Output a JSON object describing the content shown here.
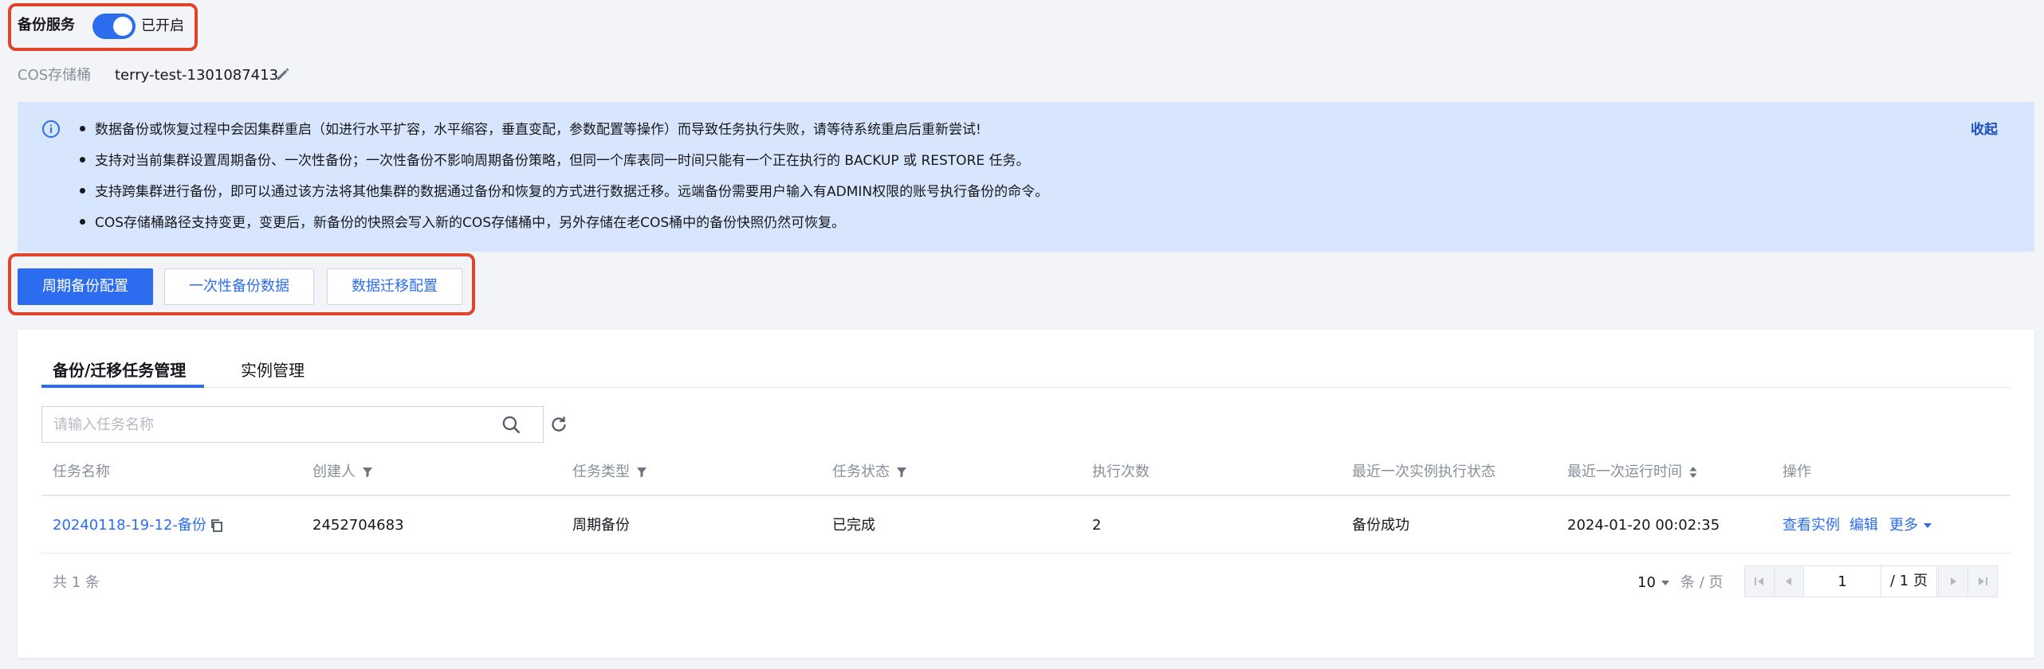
{
  "backup_service": {
    "label": "备份服务",
    "status": "已开启",
    "enabled": true
  },
  "cos_bucket": {
    "label": "COS存储桶",
    "value": "terry-test-1301087413"
  },
  "notice": {
    "items": [
      "数据备份或恢复过程中会因集群重启（如进行水平扩容，水平缩容，垂直变配，参数配置等操作）而导致任务执行失败，请等待系统重启后重新尝试!",
      "支持对当前集群设置周期备份、一次性备份；一次性备份不影响周期备份策略，但同一个库表同一时间只能有一个正在执行的 BACKUP 或 RESTORE 任务。",
      "支持跨集群进行备份，即可以通过该方法将其他集群的数据通过备份和恢复的方式进行数据迁移。远端备份需要用户输入有ADMIN权限的账号执行备份的命令。",
      "COS存储桶路径支持变更，变更后，新备份的快照会写入新的COS存储桶中，另外存储在老COS桶中的备份快照仍然可恢复。"
    ],
    "collapse_label": "收起"
  },
  "config_buttons": {
    "periodic": "周期备份配置",
    "one_time": "一次性备份数据",
    "migration": "数据迁移配置"
  },
  "tabs": {
    "task_mgmt": "备份/迁移任务管理",
    "instance_mgmt": "实例管理",
    "active": "task_mgmt"
  },
  "search": {
    "placeholder": "请输入任务名称",
    "value": ""
  },
  "table": {
    "headers": {
      "name": "任务名称",
      "creator": "创建人",
      "type": "任务类型",
      "status": "任务状态",
      "runs": "执行次数",
      "last_instance_status": "最近一次实例执行状态",
      "last_run_time": "最近一次运行时间",
      "ops": "操作"
    },
    "rows": [
      {
        "name": "20240118-19-12-备份",
        "creator": "2452704683",
        "type": "周期备份",
        "status": "已完成",
        "runs": "2",
        "last_instance_status": "备份成功",
        "last_run_time": "2024-01-20 00:02:35",
        "ops": {
          "view": "查看实例",
          "edit": "编辑",
          "more": "更多"
        }
      }
    ]
  },
  "footer": {
    "total": "共 1 条",
    "page_size": "10",
    "page_size_unit": "条 / 页",
    "current_page": "1",
    "total_pages": "/ 1 页"
  },
  "colors": {
    "accent": "#2c6df0",
    "highlight": "#e0452b",
    "banner": "#d8e6fd"
  }
}
